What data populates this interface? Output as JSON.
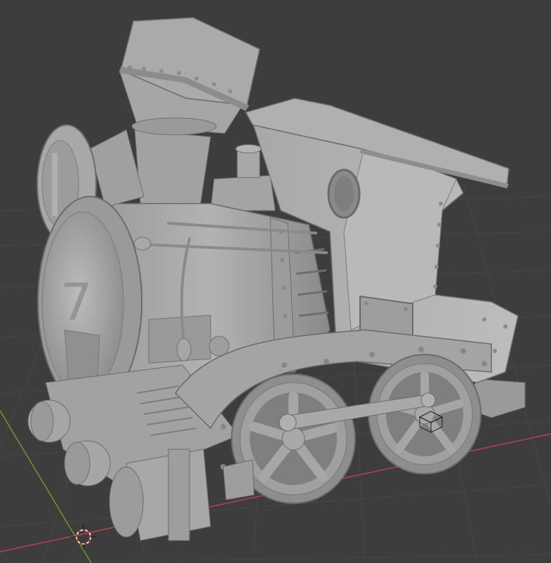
{
  "viewport": {
    "background_color": "#3d3d3d",
    "grid_color": "#4a4a4a",
    "x_axis_color": "#b8434c",
    "y_axis_color": "#6f9a2a",
    "model_base_color": "#a7a7a7",
    "model_shadow_color": "#7a7a7a",
    "model_highlight_color": "#c4c4c4"
  },
  "scene_objects": {
    "model": "steam-locomotive-model",
    "cursor": "3d-cursor-icon",
    "origin_gizmo": "cube-gizmo-icon"
  }
}
